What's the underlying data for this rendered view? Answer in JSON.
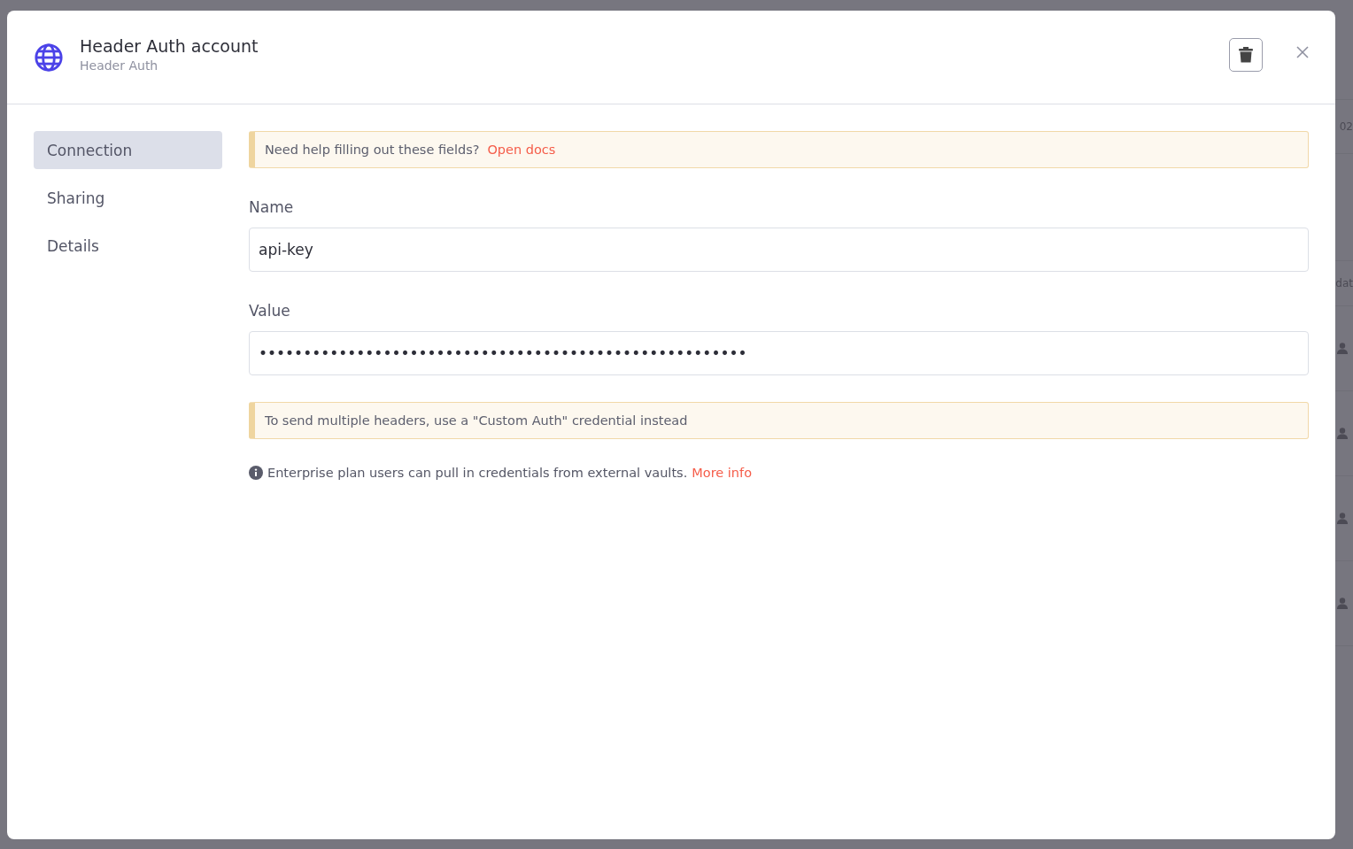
{
  "backdrop": {
    "rows": [
      {
        "kind": "line"
      },
      {
        "kind": "text",
        "text": "02"
      },
      {
        "kind": "line"
      },
      {
        "kind": "text",
        "text": "dat"
      },
      {
        "kind": "user"
      },
      {
        "kind": "user"
      },
      {
        "kind": "user"
      },
      {
        "kind": "user"
      }
    ]
  },
  "modal": {
    "title": "Header Auth account",
    "subtitle": "Header Auth"
  },
  "sidebar": {
    "items": [
      {
        "label": "Connection",
        "selected": true
      },
      {
        "label": "Sharing",
        "selected": false
      },
      {
        "label": "Details",
        "selected": false
      }
    ]
  },
  "help_notice": {
    "text": "Need help filling out these fields?",
    "link": "Open docs"
  },
  "fields": [
    {
      "label": "Name",
      "value": "api-key"
    },
    {
      "label": "Value",
      "value": "•••••••••••••••••••••••••••••••••••••••••••••••••••••••"
    }
  ],
  "warning_notice": {
    "text": "To send multiple headers, use a \"Custom Auth\" credential instead"
  },
  "info": {
    "text": "Enterprise plan users can pull in credentials from external vaults.",
    "link": "More info"
  }
}
